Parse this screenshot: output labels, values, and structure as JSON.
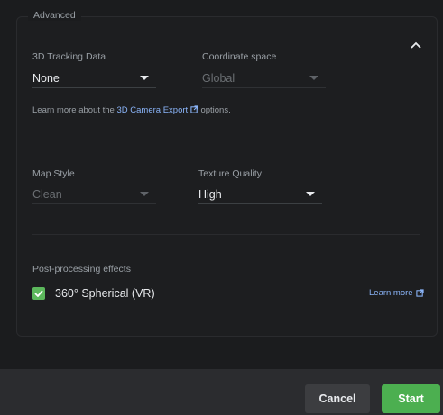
{
  "section": {
    "title": "Advanced"
  },
  "tracking": {
    "label": "3D Tracking Data",
    "value": "None"
  },
  "coordinate": {
    "label": "Coordinate space",
    "value": "Global"
  },
  "help": {
    "prefix": "Learn more about the ",
    "link": "3D Camera Export",
    "suffix": " options."
  },
  "map_style": {
    "label": "Map Style",
    "value": "Clean"
  },
  "texture": {
    "label": "Texture Quality",
    "value": "High"
  },
  "post": {
    "label": "Post-processing effects",
    "checkbox_label": "360° Spherical (VR)",
    "checked": true,
    "learn_more": "Learn more"
  },
  "footer": {
    "cancel": "Cancel",
    "start": "Start"
  },
  "colors": {
    "accent_green": "#4caf50",
    "link_blue": "#8ab4f8"
  },
  "icons": {
    "collapse": "chevron-up-icon",
    "external": "external-link-icon",
    "dropdown": "caret-down-icon",
    "check": "checkmark-icon"
  }
}
